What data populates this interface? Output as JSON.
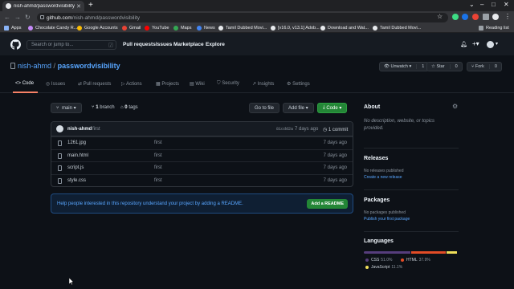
{
  "browser": {
    "tab_title": "nish-ahmd/passwordvisibility",
    "url_host": "github.com",
    "url_path": "/nish-ahmd/passwordvisibility",
    "bookmarks": [
      "Apps",
      "Chocolate Candy R...",
      "Google Accounts",
      "Gmail",
      "YouTube",
      "Maps",
      "News",
      "[v16.0, v13.1] Adob...",
      "Download and Wat...",
      "Tamil Dubbed Movi..."
    ],
    "bookmark_mid": "Tamil Dubbed Movi...",
    "reading_list": "Reading list"
  },
  "github": {
    "search_placeholder": "Search or jump to...",
    "search_kbd": "/",
    "nav": [
      "Pull requests",
      "Issues",
      "Marketplace",
      "Explore"
    ]
  },
  "repo": {
    "owner": "nish-ahmd",
    "separator": "/",
    "name": "passwordvisibility",
    "unwatch_label": "Unwatch",
    "unwatch_count": "1",
    "star_label": "Star",
    "star_count": "0",
    "fork_label": "Fork",
    "fork_count": "0",
    "tabs": [
      "Code",
      "Issues",
      "Pull requests",
      "Actions",
      "Projects",
      "Wiki",
      "Security",
      "Insights",
      "Settings"
    ],
    "branch": "main",
    "branch_count": "1",
    "branch_label": "branch",
    "tag_count": "0",
    "tag_label": "tags",
    "goto_file": "Go to file",
    "add_file": "Add file",
    "code_btn": "Code"
  },
  "commit": {
    "author": "nish-ahmd",
    "message": "first",
    "hash": "81cdd2a",
    "time": "7 days ago",
    "count": "1 commit"
  },
  "files": [
    {
      "name": "1261.jpg",
      "message": "first",
      "time": "7 days ago"
    },
    {
      "name": "main.html",
      "message": "first",
      "time": "7 days ago"
    },
    {
      "name": "script.js",
      "message": "first",
      "time": "7 days ago"
    },
    {
      "name": "style.css",
      "message": "first",
      "time": "7 days ago"
    }
  ],
  "readme": {
    "text": "Help people interested in this repository understand your project by adding a README.",
    "button": "Add a README"
  },
  "sidebar": {
    "about_title": "About",
    "about_desc": "No description, website, or topics provided.",
    "releases_title": "Releases",
    "releases_none": "No releases published",
    "releases_link": "Create a new release",
    "packages_title": "Packages",
    "packages_none": "No packages published",
    "packages_link": "Publish your first package",
    "languages_title": "Languages",
    "languages": [
      {
        "name": "CSS",
        "percent": "51.0%",
        "value": 51.0,
        "color": "#563d7c"
      },
      {
        "name": "HTML",
        "percent": "37.9%",
        "value": 37.9,
        "color": "#e34c26"
      },
      {
        "name": "JavaScript",
        "percent": "11.1%",
        "value": 11.1,
        "color": "#f1e05a"
      }
    ]
  }
}
